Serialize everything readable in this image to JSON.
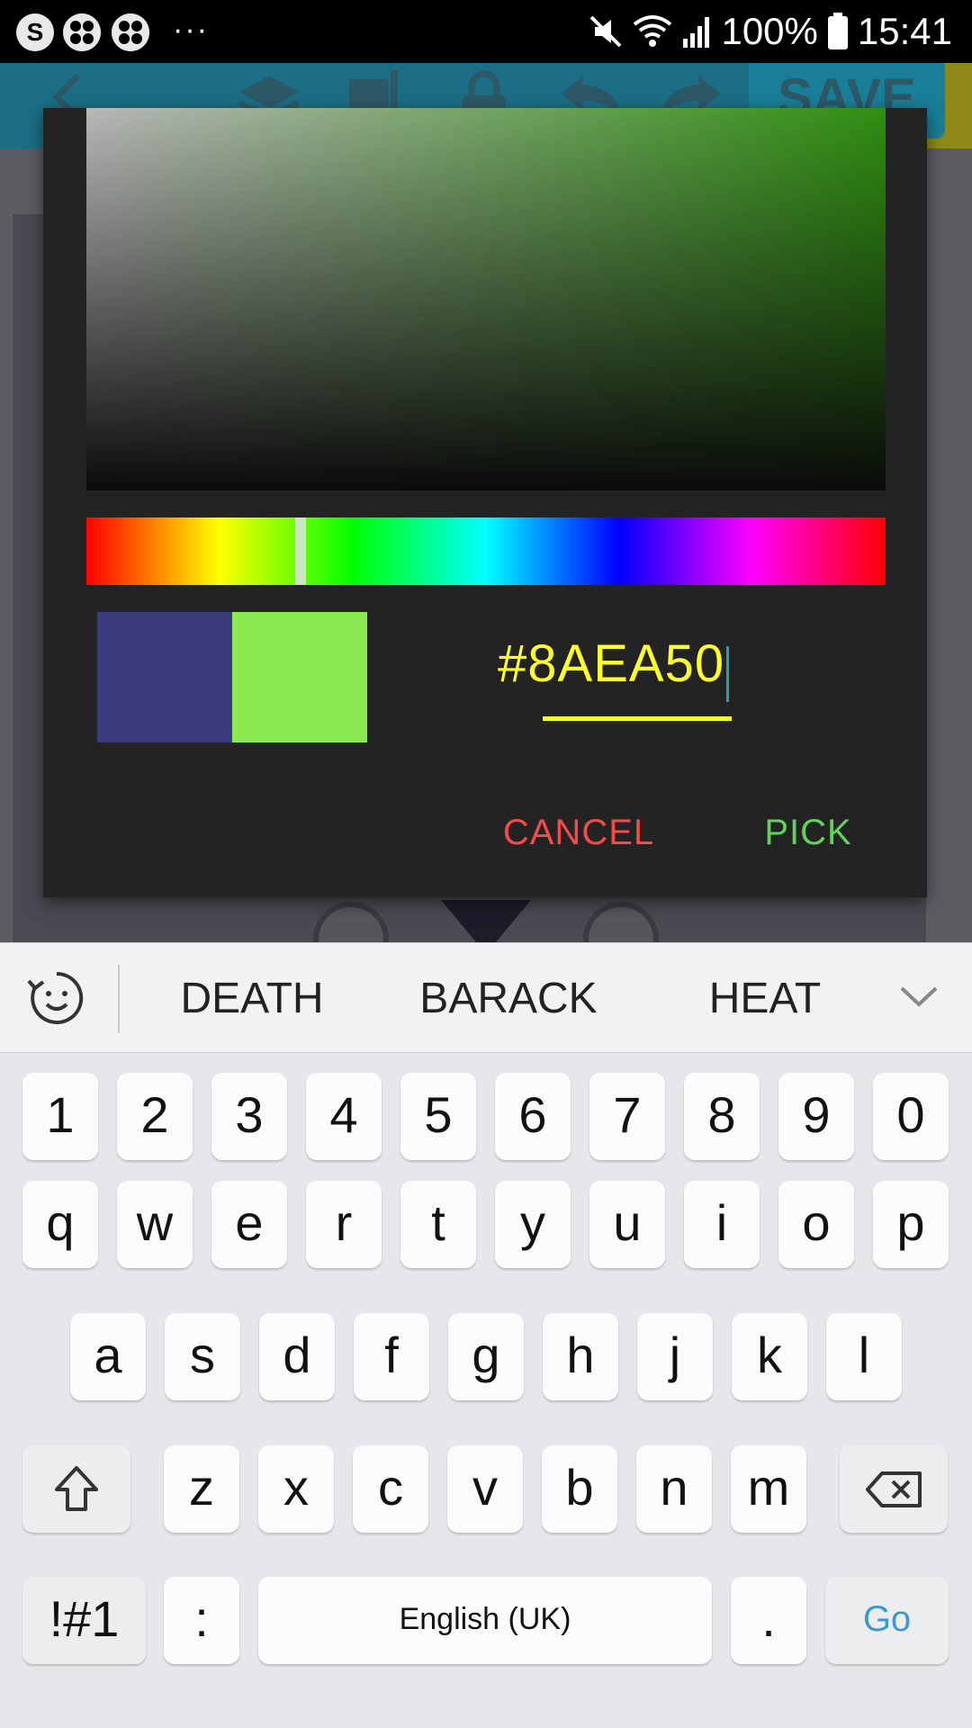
{
  "status_bar": {
    "app_icons": [
      "S",
      "flower-icon",
      "flower-icon"
    ],
    "overflow": "···",
    "battery_text": "100%",
    "time": "15:41"
  },
  "app_toolbar": {
    "save_label": "SAVE"
  },
  "color_picker": {
    "hex_value": "#8AEA50",
    "old_color": "#3a3c7b",
    "new_color": "#8aea50",
    "hue_accent": "#37c40a",
    "cancel_label": "CANCEL",
    "pick_label": "PICK"
  },
  "keyboard": {
    "suggestions": [
      "DEATH",
      "BARACK",
      "HEAT"
    ],
    "row1": [
      "1",
      "2",
      "3",
      "4",
      "5",
      "6",
      "7",
      "8",
      "9",
      "0"
    ],
    "row2": [
      "q",
      "w",
      "e",
      "r",
      "t",
      "y",
      "u",
      "i",
      "o",
      "p"
    ],
    "row3": [
      "a",
      "s",
      "d",
      "f",
      "g",
      "h",
      "j",
      "k",
      "l"
    ],
    "row4": [
      "z",
      "x",
      "c",
      "v",
      "b",
      "n",
      "m"
    ],
    "symbols_label": "!#1",
    "colon_label": ":",
    "space_label": "English (UK)",
    "period_label": ".",
    "go_label": "Go"
  }
}
